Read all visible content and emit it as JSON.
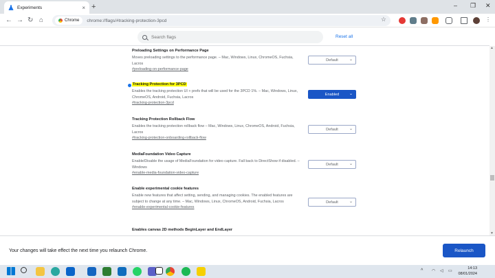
{
  "browser": {
    "tab_title": "Experiments",
    "tab_close": "×",
    "new_tab": "+",
    "chip_label": "Chrome",
    "url": "chrome://flags/#tracking-protection-3pcd",
    "minimize": "–",
    "maximize": "❐",
    "close": "✕",
    "back": "←",
    "forward": "→",
    "reload": "↻",
    "home": "⌂",
    "star": "☆",
    "icons": [
      "flask-icon",
      "back-arrow-icon",
      "forward-arrow-icon",
      "reload-icon",
      "home-icon",
      "star-icon"
    ]
  },
  "flags_page": {
    "search_placeholder": "Search flags",
    "reset_all": "Reset all",
    "flags": [
      {
        "title": "Preloading Settings on Performance Page",
        "desc": "Moves preloading settings to the performance page. – Mac, Windows, Linux, ChromeOS, Fuchsia, Lacros",
        "link": "#preloading-on-performance-page",
        "value": "Default"
      },
      {
        "title": "Tracking Protection for 3PCD",
        "desc": "Enables the tracking protection UI + prefs that will be used for the 3PCD 1%. – Mac, Windows, Linux, ChromeOS, Android, Fuchsia, Lacros",
        "link": "#tracking-protection-3pcd",
        "value": "Enabled"
      },
      {
        "title": "Tracking Protection Rollback Flow",
        "desc": "Enables the tracking protection rollback flow – Mac, Windows, Linux, ChromeOS, Android, Fuchsia, Lacros",
        "link": "#tracking-protection-onboarding-rollback-flow",
        "value": "Default"
      },
      {
        "title": "MediaFoundation Video Capture",
        "desc": "Enable/Disable the usage of MediaFoundation for video capture. Fall back to DirectShow if disabled. – Windows",
        "link": "#enable-media-foundation-video-capture",
        "value": "Default"
      },
      {
        "title": "Enable experimental cookie features",
        "desc": "Enable new features that affect setting, sending, and managing cookies. The enabled features are subject to change at any time. – Mac, Windows, Linux, ChromeOS, Android, Fuchsia, Lacros",
        "link": "#enable-experimental-cookie-features",
        "value": "Default"
      },
      {
        "title": "Enables canvas 2D methods BeginLayer and EndLayer",
        "desc": "",
        "link": "",
        "value": ""
      }
    ]
  },
  "relaunch": {
    "message": "Your changes will take effect the next time you relaunch Chrome.",
    "button": "Relaunch"
  },
  "taskbar": {
    "time": "14:13",
    "date": "08/01/2024",
    "tray_up": "^",
    "icons": [
      "windows-start-icon",
      "search-icon",
      "file-explorer-icon",
      "edge-icon",
      "mail-icon",
      "outlook-icon",
      "whatsapp-icon",
      "teams-icon",
      "notion-icon",
      "chrome-icon",
      "spotify-icon",
      "sticky-notes-icon",
      "wifi-icon",
      "volume-icon",
      "battery-icon"
    ]
  }
}
